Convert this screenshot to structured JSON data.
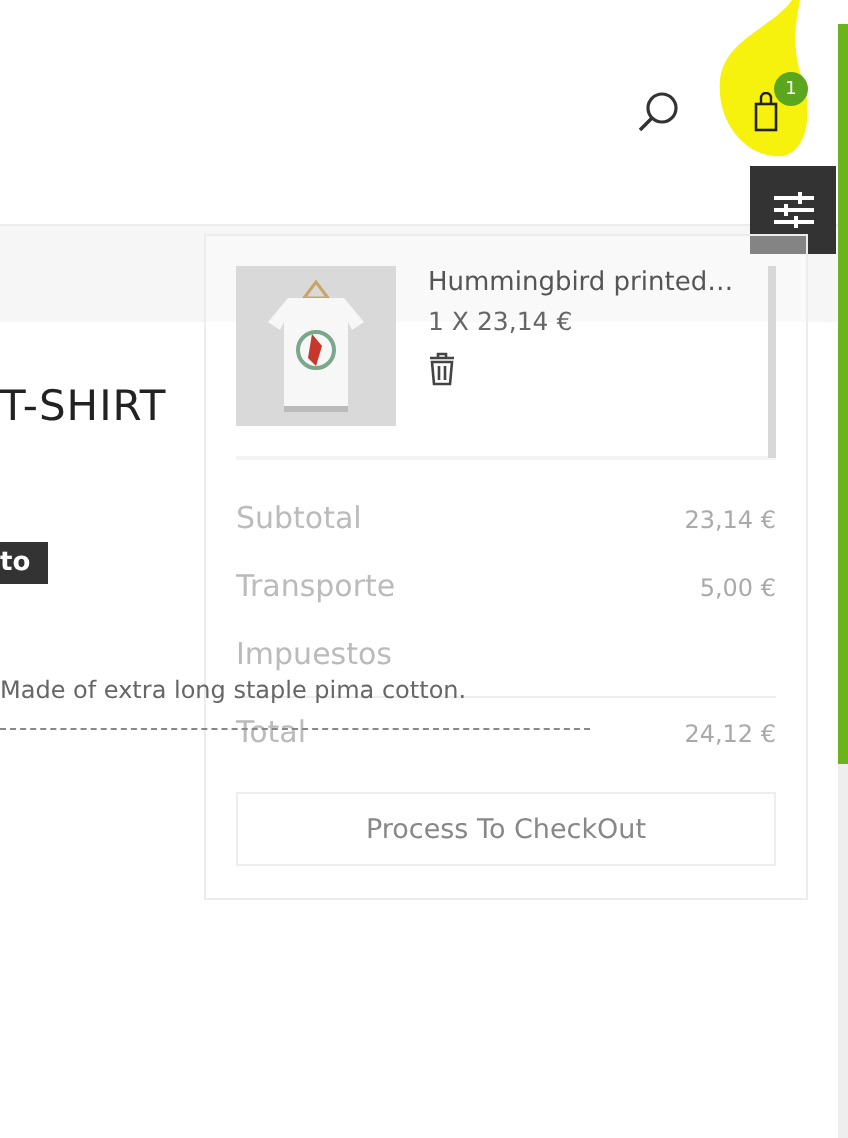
{
  "header": {
    "cart_count": "1"
  },
  "product": {
    "title": "T-SHIRT",
    "tag": "to",
    "description": "Made of extra long staple pima cotton."
  },
  "cart_dropdown": {
    "items": [
      {
        "name": "Hummingbird printed…",
        "quantity_price": "1 X 23,14 €",
        "kind": "picture"
      }
    ],
    "totals": [
      {
        "label": "Subtotal",
        "value": "23,14 €",
        "divider": false
      },
      {
        "label": "Transporte",
        "value": "5,00 €",
        "divider": false
      },
      {
        "label": "Impuestos",
        "divider": false
      },
      {
        "label": "Total",
        "value": "24,12 €",
        "divider": true
      }
    ],
    "checkout_button": "Process To CheckOut"
  }
}
